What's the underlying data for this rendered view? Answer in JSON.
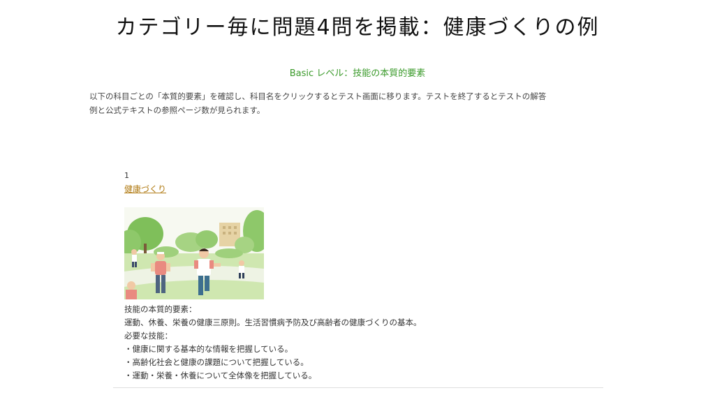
{
  "slide": {
    "title": "カテゴリー毎に問題4問を掲載：健康づくりの例"
  },
  "page": {
    "level_heading": "Basic レベル：技能の本質的要素",
    "intro_line1": "以下の科目ごとの「本質的要素」を確認し、科目名をクリックするとテスト画面に移ります。テストを終了するとテストの解答",
    "intro_line2": "例と公式テキストの参照ページ数が見られます。",
    "subject": {
      "number": "1",
      "link_label": "健康づくり",
      "image_icon": "park-jogging-illustration",
      "essential_label": "技能の本質的要素：",
      "essential_text": "運動、休養、栄養の健康三原則。生活習慣病予防及び高齢者の健康づくりの基本。",
      "skills_label": "必要な技能：",
      "skills": [
        "・健康に関する基本的な情報を把握している。",
        "・高齢化社会と健康の課題について把握している。",
        "・運動・栄養・休養について全体像を把握している。"
      ]
    }
  },
  "colors": {
    "heading_green": "#3a9a2a",
    "link_gold": "#b07a12"
  }
}
